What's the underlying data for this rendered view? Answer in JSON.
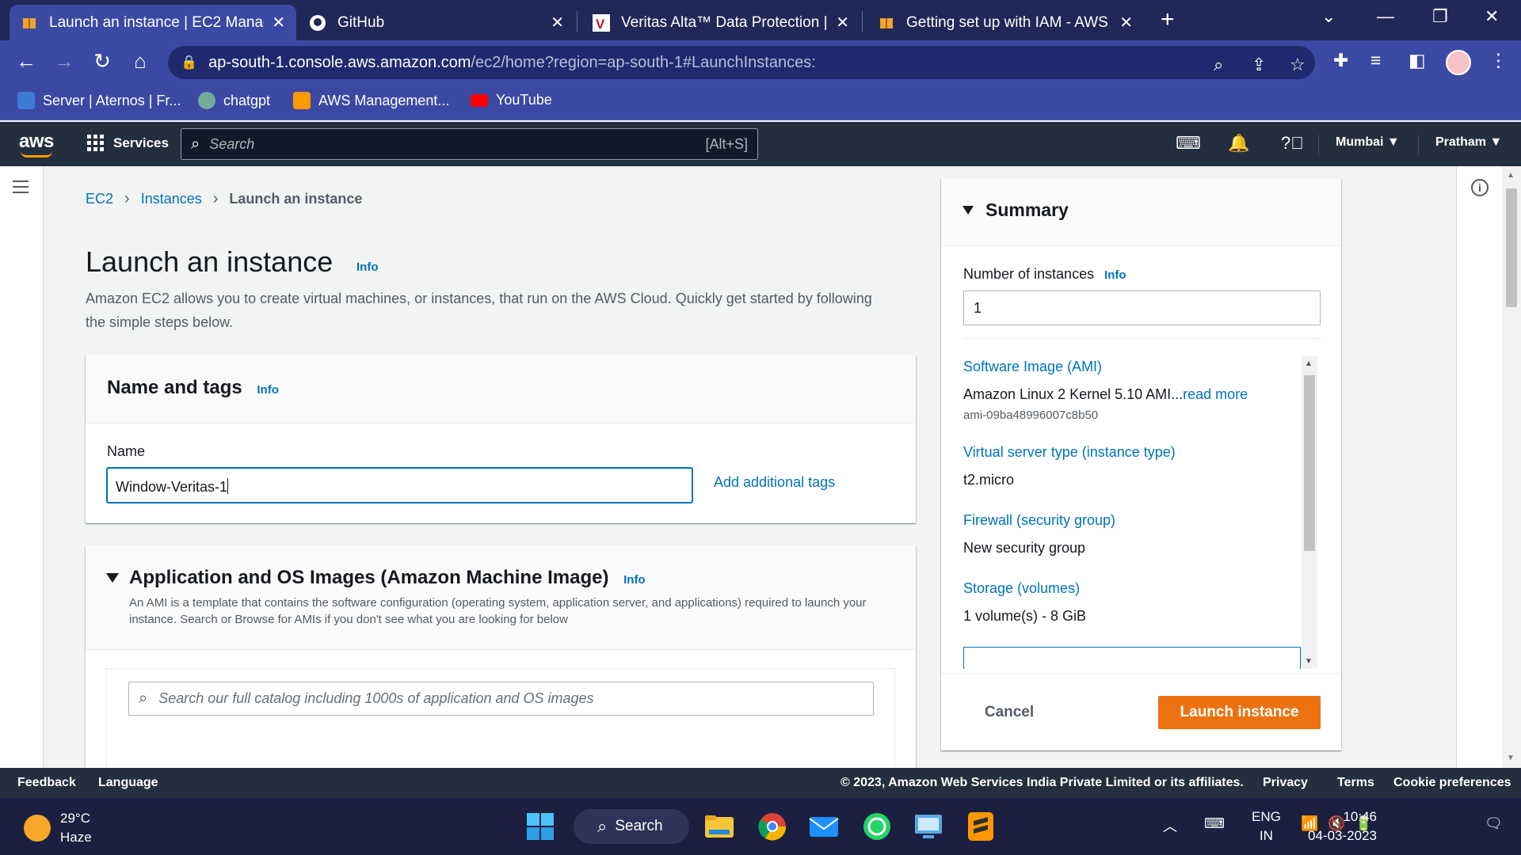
{
  "browser": {
    "tabs": [
      {
        "title": "Launch an instance | EC2 Manage",
        "active": true
      },
      {
        "title": "GitHub",
        "active": false
      },
      {
        "title": "Veritas Alta™ Data Protection | Ve",
        "active": false
      },
      {
        "title": "Getting set up with IAM - AWS Id",
        "active": false
      }
    ],
    "url_host": "ap-south-1.console.aws.amazon.com",
    "url_path": "/ec2/home?region=ap-south-1#LaunchInstances:",
    "bookmarks": [
      {
        "label": "Server | Aternos | Fr...",
        "color": "#3d7bd9"
      },
      {
        "label": "chatgpt",
        "color": "#74aa9c"
      },
      {
        "label": "AWS Management...",
        "color": "#ff9900"
      },
      {
        "label": "YouTube",
        "color": "#ff0000"
      }
    ]
  },
  "aws_header": {
    "logo": "aws",
    "services": "Services",
    "search_placeholder": "Search",
    "search_shortcut": "[Alt+S]",
    "region": "Mumbai",
    "user": "Pratham"
  },
  "breadcrumb": {
    "items": [
      "EC2",
      "Instances"
    ],
    "current": "Launch an instance"
  },
  "page": {
    "title": "Launch an instance",
    "info": "Info",
    "description": "Amazon EC2 allows you to create virtual machines, or instances, that run on the AWS Cloud. Quickly get started by following the simple steps below."
  },
  "name_tags": {
    "title": "Name and tags",
    "info": "Info",
    "name_label": "Name",
    "name_value": "Window-Veritas-1",
    "add_tags": "Add additional tags"
  },
  "ami": {
    "title": "Application and OS Images (Amazon Machine Image)",
    "info": "Info",
    "description": "An AMI is a template that contains the software configuration (operating system, application server, and applications) required to launch your instance. Search or Browse for AMIs if you don't see what you are looking for below",
    "search_placeholder": "Search our full catalog including 1000s of application and OS images"
  },
  "summary": {
    "title": "Summary",
    "num_label": "Number of instances",
    "info": "Info",
    "num_value": "1",
    "ami_label": "Software Image (AMI)",
    "ami_value": "Amazon Linux 2 Kernel 5.10 AMI...",
    "read_more": "read more",
    "ami_id": "ami-09ba48996007c8b50",
    "type_label": "Virtual server type (instance type)",
    "type_value": "t2.micro",
    "firewall_label": "Firewall (security group)",
    "firewall_value": "New security group",
    "storage_label": "Storage (volumes)",
    "storage_value": "1 volume(s) - 8 GiB",
    "cancel": "Cancel",
    "launch": "Launch instance"
  },
  "footer": {
    "feedback": "Feedback",
    "language": "Language",
    "copyright": "© 2023, Amazon Web Services India Private Limited or its affiliates.",
    "privacy": "Privacy",
    "terms": "Terms",
    "cookies": "Cookie preferences"
  },
  "taskbar": {
    "temp": "29°C",
    "weather": "Haze",
    "search": "Search",
    "lang_top": "ENG",
    "lang_bottom": "IN",
    "time": "10:46",
    "date": "04-03-2023"
  },
  "colors": {
    "aws_dark": "#232f3e",
    "link": "#0073bb",
    "launch_orange": "#ec7211",
    "browser_tab": "#3c49a3"
  }
}
